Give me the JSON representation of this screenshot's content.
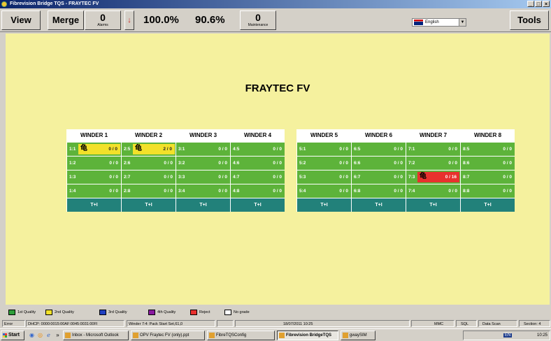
{
  "window": {
    "title": "Fibrevision Bridge TQS - FRAYTEC FV",
    "min": "_",
    "max": "□",
    "close": "×"
  },
  "toolbar": {
    "view": "View",
    "merge": "Merge",
    "alarms_count": "0",
    "alarms_label": "Alarms",
    "trend_arrow": "↓",
    "pct1": "100.0%",
    "pct2": "90.6%",
    "maintenance_count": "0",
    "maintenance_label": "Maintenance",
    "language": "English",
    "tools": "Tools"
  },
  "page": {
    "title": "FRAYTEC FV"
  },
  "winders": [
    {
      "name": "WINDER 1",
      "positions": [
        {
          "id": "1:1",
          "count": "0 / 0",
          "state": "yellow",
          "icon": "⻳"
        },
        {
          "id": "1:2",
          "count": "0 / 0",
          "state": "green"
        },
        {
          "id": "1:3",
          "count": "0 / 0",
          "state": "green"
        },
        {
          "id": "1:4",
          "count": "0 / 0",
          "state": "green"
        }
      ],
      "footer": "T+I"
    },
    {
      "name": "WINDER 2",
      "positions": [
        {
          "id": "2:5",
          "count": "2 / 0",
          "state": "yellow",
          "icon": "⻳"
        },
        {
          "id": "2:6",
          "count": "0 / 0",
          "state": "green"
        },
        {
          "id": "2:7",
          "count": "0 / 0",
          "state": "green"
        },
        {
          "id": "2:8",
          "count": "0 / 0",
          "state": "green"
        }
      ],
      "footer": "T+I"
    },
    {
      "name": "WINDER 3",
      "positions": [
        {
          "id": "3:1",
          "count": "0 / 0",
          "state": "green"
        },
        {
          "id": "3:2",
          "count": "0 / 0",
          "state": "green"
        },
        {
          "id": "3:3",
          "count": "0 / 0",
          "state": "green"
        },
        {
          "id": "3:4",
          "count": "0 / 0",
          "state": "green"
        }
      ],
      "footer": "T+I"
    },
    {
      "name": "WINDER 4",
      "positions": [
        {
          "id": "4:5",
          "count": "0 / 0",
          "state": "green"
        },
        {
          "id": "4:6",
          "count": "0 / 0",
          "state": "green"
        },
        {
          "id": "4:7",
          "count": "0 / 0",
          "state": "green"
        },
        {
          "id": "4:8",
          "count": "0 / 0",
          "state": "green"
        }
      ],
      "footer": "T+I"
    },
    {
      "name": "WINDER 5",
      "positions": [
        {
          "id": "5:1",
          "count": "0 / 0",
          "state": "green"
        },
        {
          "id": "5:2",
          "count": "0 / 0",
          "state": "green"
        },
        {
          "id": "5:3",
          "count": "0 / 0",
          "state": "green"
        },
        {
          "id": "5:4",
          "count": "0 / 0",
          "state": "green"
        }
      ],
      "footer": "T+I"
    },
    {
      "name": "WINDER 6",
      "positions": [
        {
          "id": "6:5",
          "count": "0 / 0",
          "state": "green"
        },
        {
          "id": "6:6",
          "count": "0 / 0",
          "state": "green"
        },
        {
          "id": "6:7",
          "count": "0 / 0",
          "state": "green"
        },
        {
          "id": "6:8",
          "count": "0 / 0",
          "state": "green"
        }
      ],
      "footer": "T+I"
    },
    {
      "name": "WINDER 7",
      "positions": [
        {
          "id": "7:1",
          "count": "0 / 0",
          "state": "green"
        },
        {
          "id": "7:2",
          "count": "0 / 0",
          "state": "green"
        },
        {
          "id": "7:3",
          "count": "0 / 16",
          "state": "red",
          "icon": "⻳"
        },
        {
          "id": "7:4",
          "count": "0 / 0",
          "state": "green"
        }
      ],
      "footer": "T+I"
    },
    {
      "name": "WINDER 8",
      "positions": [
        {
          "id": "8:5",
          "count": "0 / 0",
          "state": "green"
        },
        {
          "id": "8:6",
          "count": "0 / 0",
          "state": "green"
        },
        {
          "id": "8:7",
          "count": "0 / 0",
          "state": "green"
        },
        {
          "id": "8:8",
          "count": "0 / 0",
          "state": "green"
        }
      ],
      "footer": "T+I"
    }
  ],
  "legend": [
    {
      "label": "1st Quality",
      "color": "#2e9e3a"
    },
    {
      "label": "2nd Quality",
      "color": "#f2e12a"
    },
    {
      "label": "3rd Quality",
      "color": "#2040c0"
    },
    {
      "label": "4th Quality",
      "color": "#8a1aa0"
    },
    {
      "label": "Reject",
      "color": "#e8312e"
    },
    {
      "label": "No grade",
      "color": "#ffffff"
    }
  ],
  "status": {
    "error": "Error",
    "dhcp": "DHCP: 0000:0015:00AF:0045:0031:00FI",
    "winder": "Winder 7:4: Pack Start Set,61,0",
    "datetime": "18/07/2011 10:25",
    "mmc": "MMC",
    "sql": "SQL",
    "datascan": "Data Scan",
    "section": "Section: 4"
  },
  "taskbar": {
    "start": "Start",
    "tasks": [
      {
        "label": "Inbox - Microsoft Outlook"
      },
      {
        "label": "OPV Fraytec FV (only).ppt"
      },
      {
        "label": "FibreTQSConfig"
      },
      {
        "label": "Fibrevision BridgeTQS",
        "active": true
      },
      {
        "label": "gwaySIM"
      }
    ],
    "lang": "EN",
    "clock": "10:25"
  },
  "colors": {
    "background": "#f5f19e",
    "green": "#5db33a",
    "teal": "#22817a",
    "yellow": "#f2e12a",
    "red": "#e8312e"
  }
}
